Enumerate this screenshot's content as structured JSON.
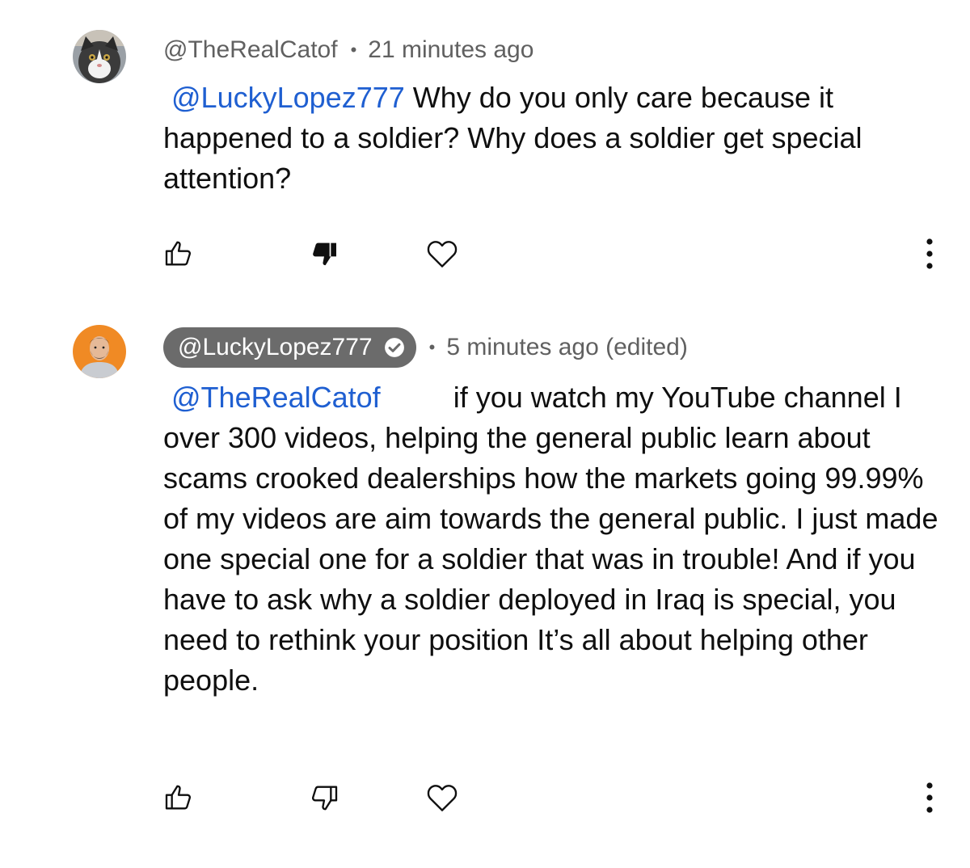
{
  "comments": [
    {
      "avatar_icon": "cat-avatar",
      "author": "@TheRealCatof",
      "separator": "•",
      "timestamp": "21 minutes ago",
      "mention": "@LuckyLopez777",
      "text": " Why do you only care because it happened to a soldier? Why does a soldier get special attention?",
      "disliked": true
    },
    {
      "avatar_icon": "man-avatar",
      "author": "@LuckyLopez777",
      "verified": true,
      "separator": "•",
      "timestamp": "5 minutes ago (edited)",
      "mention": "@TheRealCatof",
      "text": "if you watch my YouTube channel I over 300 videos, helping the general public learn about scams crooked dealerships how the markets going 99.99% of my videos are aim towards the general public. I just made one special one for a soldier that was in trouble! And if you have to ask why a soldier deployed in Iraq is special, you need to rethink your position     It’s all about helping other people.",
      "disliked": false
    }
  ],
  "icons": {
    "like": "thumbs-up-icon",
    "dislike": "thumbs-down-icon",
    "heart": "heart-icon",
    "more": "more-vert-icon"
  },
  "colors": {
    "mention": "#1f5fd1",
    "meta": "#606060",
    "badge": "#6b6b6b",
    "avatar_bg_2": "#f08a24"
  }
}
